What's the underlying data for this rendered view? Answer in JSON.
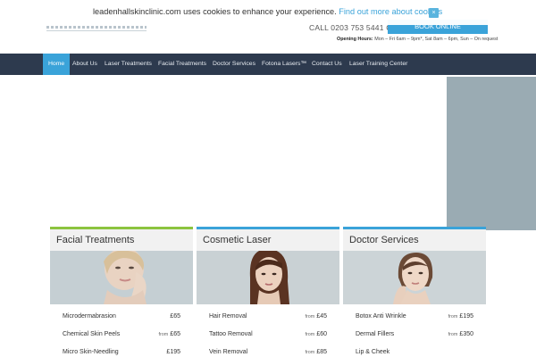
{
  "cookie": {
    "text": "leadenhallskinclinic.com uses cookies to enhance your experience.",
    "link": "Find out more about cookies",
    "close": "×"
  },
  "header": {
    "call": "CALL   0203 753 5441  OR",
    "book_label": "BOOK ONLINE",
    "hours_label": "Opening Hours:",
    "hours_value": "Mon – Fri 6am – 9pm*, Sat 8am – 6pm, Sun – On request"
  },
  "nav": {
    "items": [
      {
        "label": "Home",
        "active": true
      },
      {
        "label": "About Us"
      },
      {
        "label": "Laser Treatments"
      },
      {
        "label": "Facial Treatments"
      },
      {
        "label": "Doctor Services"
      },
      {
        "label": "Fotona Lasers™"
      },
      {
        "label": "Contact Us"
      },
      {
        "label": "Laser Training Center"
      }
    ]
  },
  "colors": {
    "nav_bg": "#2d3a4e",
    "accent": "#3aa3d9",
    "green": "#8cc43f",
    "hero_panel": "#9aabb3"
  },
  "cards": [
    {
      "title": "Facial Treatments",
      "rows": [
        {
          "name": "Microdermabrasion",
          "from": "",
          "price": "£65"
        },
        {
          "name": "Chemical Skin Peels",
          "from": "from",
          "price": "£65"
        },
        {
          "name": "Micro Skin-Needling",
          "from": "",
          "price": "£195"
        }
      ]
    },
    {
      "title": "Cosmetic Laser",
      "rows": [
        {
          "name": "Hair Removal",
          "from": "from",
          "price": "£45"
        },
        {
          "name": "Tattoo Removal",
          "from": "from",
          "price": "£60"
        },
        {
          "name": "Vein Removal",
          "from": "from",
          "price": "£85"
        }
      ]
    },
    {
      "title": "Doctor Services",
      "rows": [
        {
          "name": "Botox Anti Wrinkle",
          "from": "from",
          "price": "£195"
        },
        {
          "name": "Dermal Fillers",
          "from": "from",
          "price": "£350"
        },
        {
          "name": "Lip & Cheek",
          "from": "",
          "price": ""
        }
      ]
    }
  ]
}
